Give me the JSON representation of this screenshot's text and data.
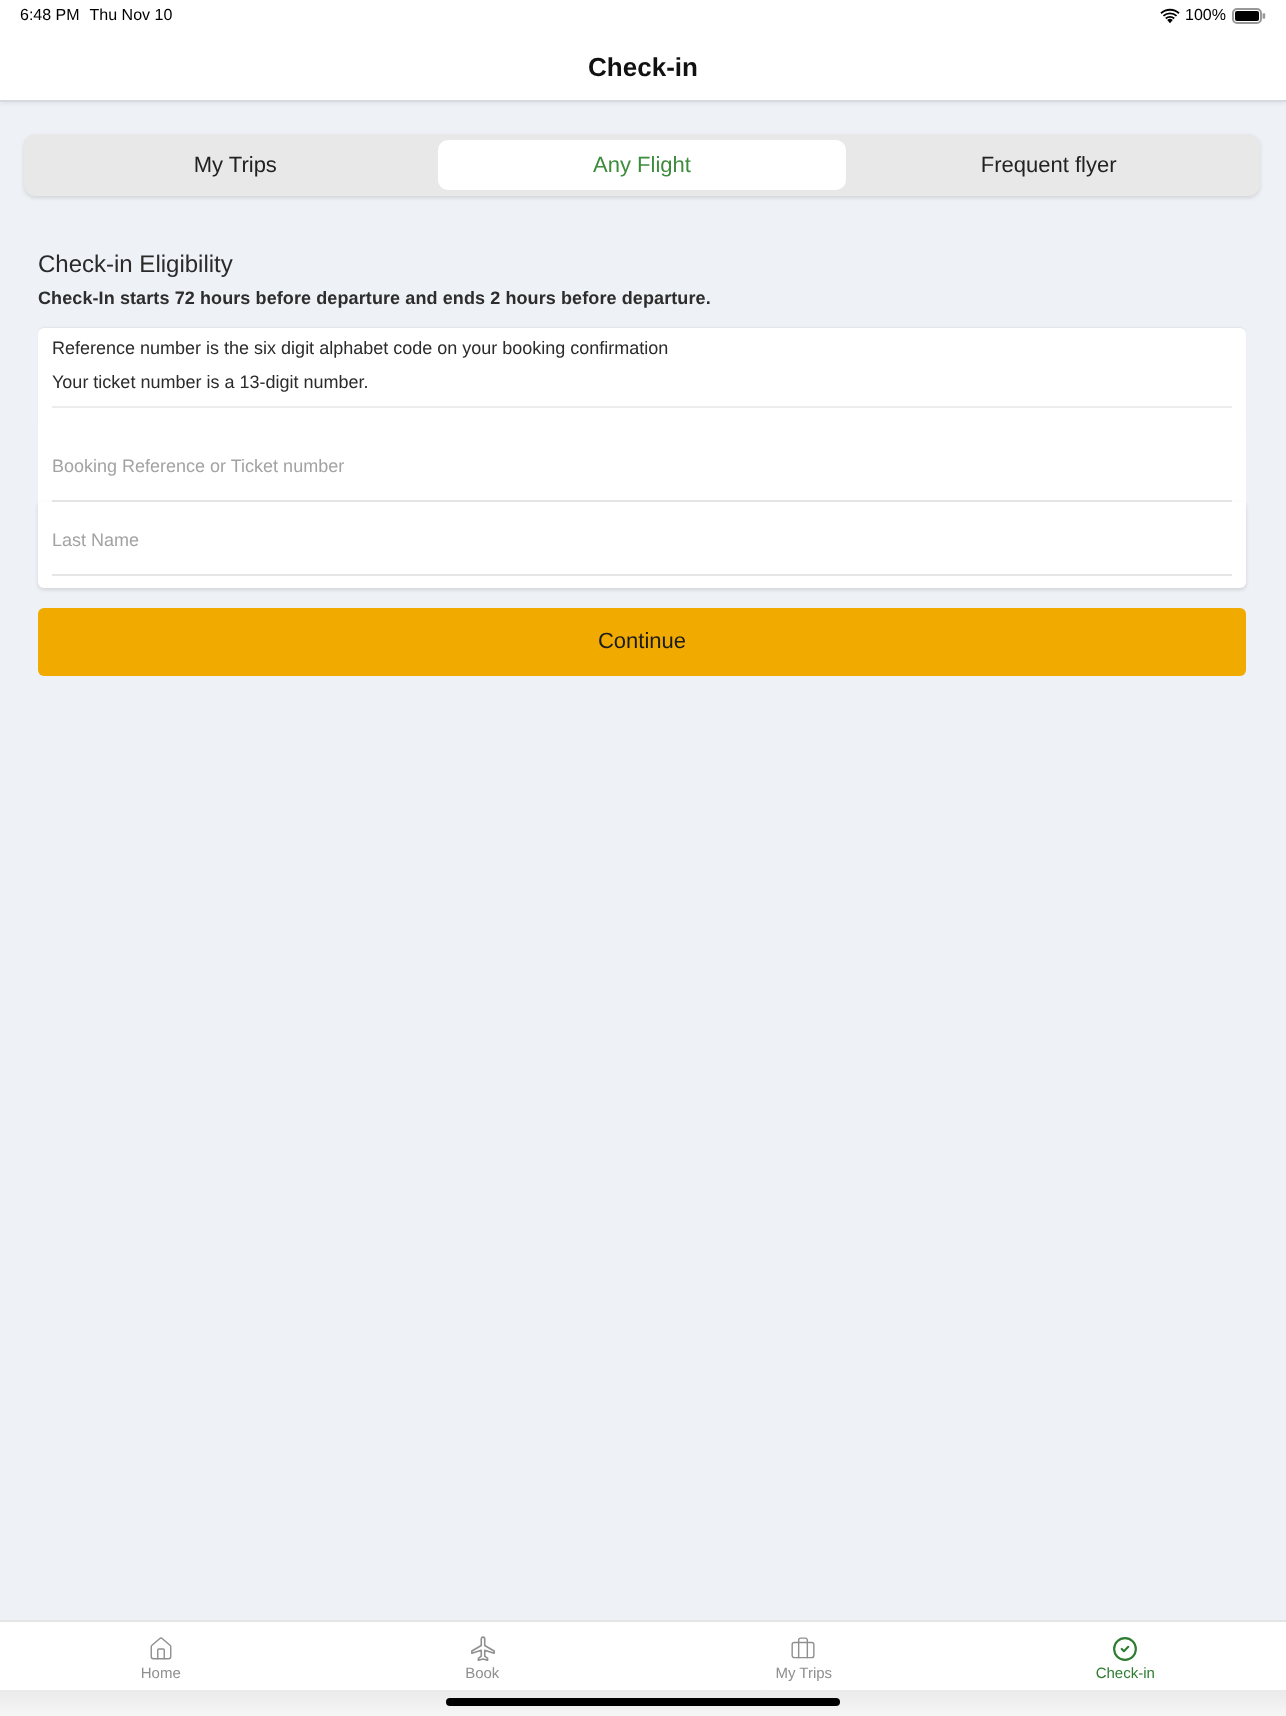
{
  "status_bar": {
    "time": "6:48 PM",
    "date": "Thu Nov 10",
    "battery": "100%"
  },
  "header": {
    "title": "Check-in"
  },
  "segments": [
    {
      "label": "My Trips",
      "selected": false
    },
    {
      "label": "Any Flight",
      "selected": true
    },
    {
      "label": "Frequent flyer",
      "selected": false
    }
  ],
  "eligibility": {
    "title": "Check-in Eligibility",
    "note": "Check-In starts 72 hours before departure and ends 2 hours before departure."
  },
  "form": {
    "hints": [
      "Reference number is the six digit alphabet code on your booking confirmation",
      "Your ticket number is a 13-digit number."
    ],
    "fields": [
      {
        "placeholder": "Booking Reference or Ticket number"
      },
      {
        "placeholder": "Last Name"
      }
    ]
  },
  "continue_button": {
    "label": "Continue"
  },
  "tab_bar": [
    {
      "kind": "home",
      "label": "Home",
      "selected": false
    },
    {
      "kind": "book",
      "label": "Book",
      "selected": false
    },
    {
      "kind": "trips",
      "label": "My Trips",
      "selected": false
    },
    {
      "kind": "checkin",
      "label": "Check-in",
      "selected": true
    }
  ]
}
